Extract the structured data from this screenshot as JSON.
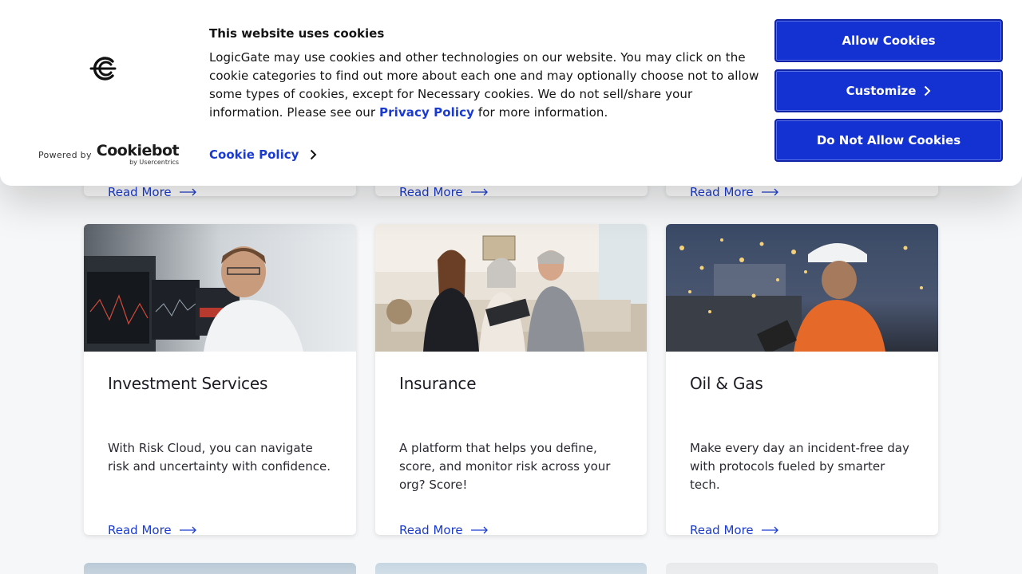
{
  "cookie_banner": {
    "title": "This website uses cookies",
    "body_before_link": "LogicGate may use cookies and other technologies on our website. You may click on the cookie categories to find out more about each one and may optionally choose not to allow some types of cookies, except for Necessary cookies.  We do not sell/share your information. Please see our ",
    "privacy_link": "Privacy Policy",
    "body_after_link": " for more information.",
    "cookie_policy_link": "Cookie Policy",
    "powered_by": "Powered by",
    "cookiebot_brand": "Cookiebot",
    "cookiebot_sub": "by Usercentrics",
    "buttons": {
      "allow": "Allow Cookies",
      "customize": "Customize",
      "deny": "Do Not Allow Cookies"
    },
    "button_color": "#1431d1"
  },
  "top_cards": [
    {
      "read_more": "Read More"
    },
    {
      "read_more": "Read More"
    },
    {
      "read_more": "Read More"
    }
  ],
  "cards": [
    {
      "title": "Investment Services",
      "description": "With Risk Cloud, you can navigate risk and uncertainty with confidence.",
      "read_more": "Read More",
      "image": "man-at-trading-monitors"
    },
    {
      "title": "Insurance",
      "description": "A platform that helps you define, score, and monitor risk across your org? Score!",
      "read_more": "Read More",
      "image": "agent-with-senior-couple"
    },
    {
      "title": "Oil & Gas",
      "description": "Make every day an incident-free day with protocols fueled by smarter tech.",
      "read_more": "Read More",
      "image": "engineer-at-refinery"
    }
  ],
  "colors": {
    "link": "#1a3ad0",
    "page_bg": "#f6f7f8"
  }
}
